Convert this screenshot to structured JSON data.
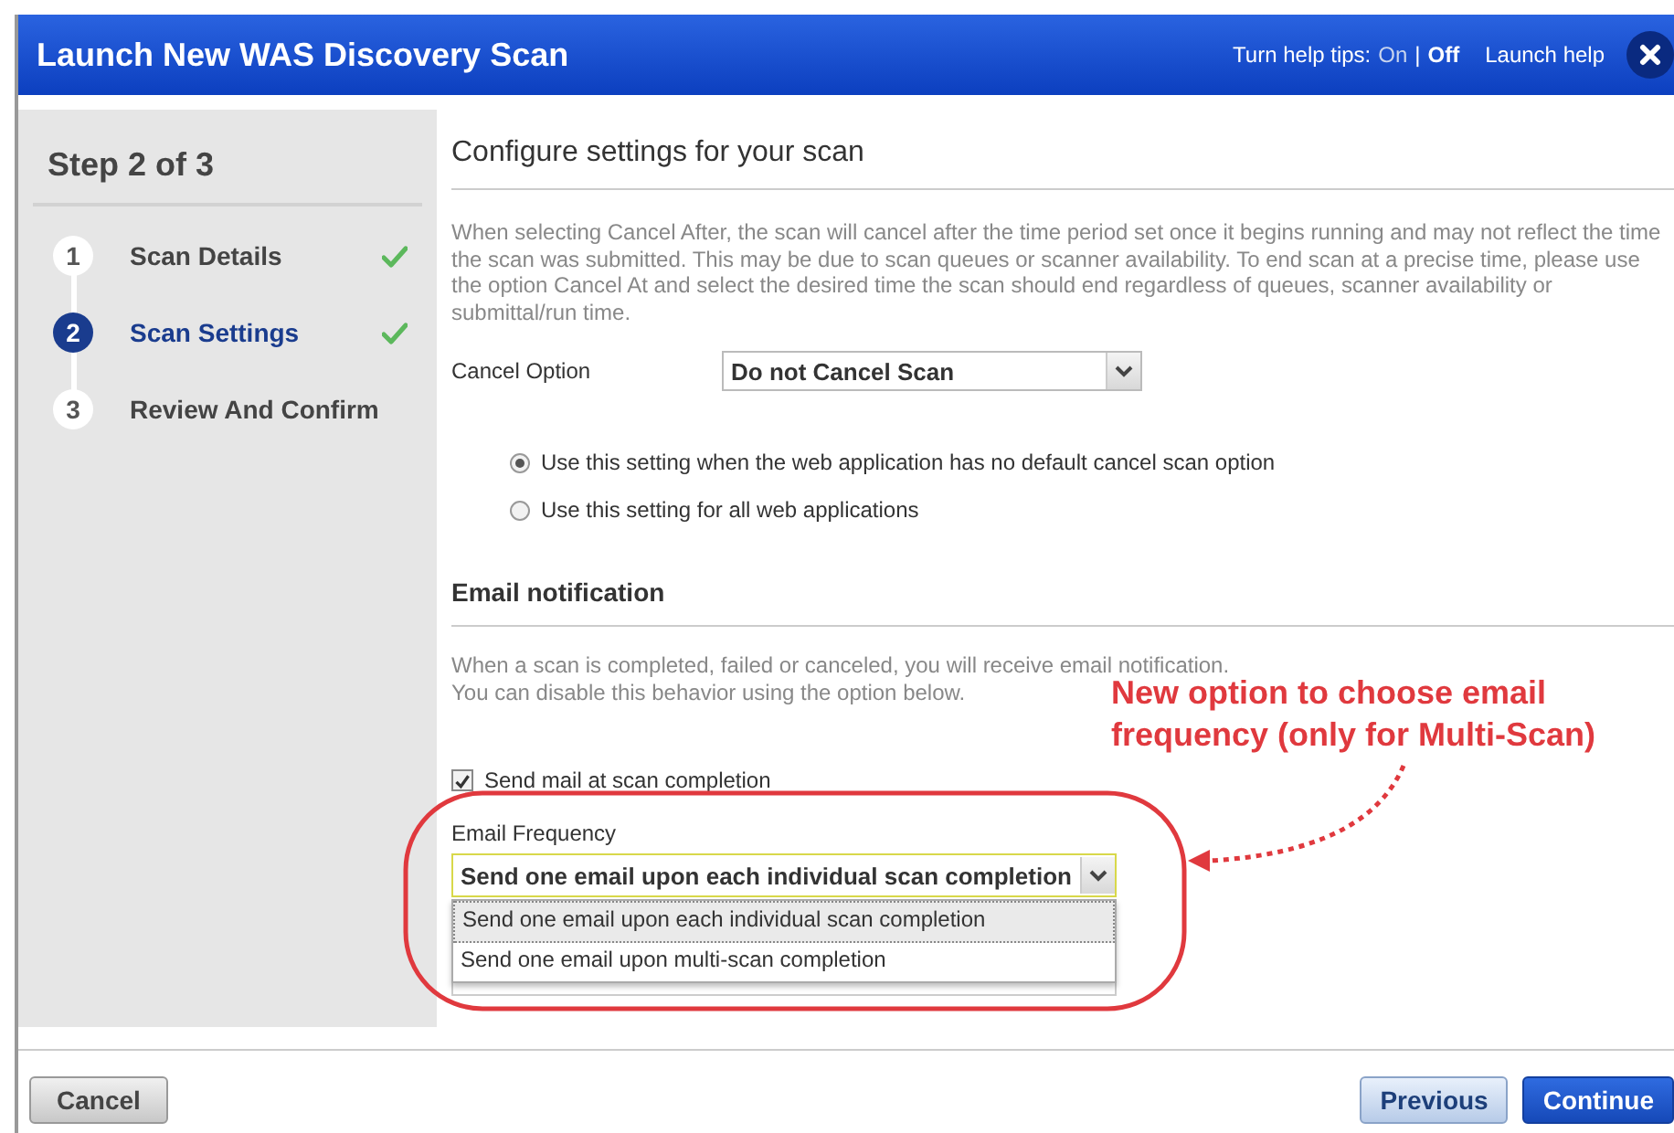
{
  "window": {
    "title": "Launch New WAS Discovery Scan",
    "help_tips_label": "Turn help tips:",
    "help_on": "On",
    "help_separator": "|",
    "help_off": "Off",
    "help_tips_on": false,
    "launch_help": "Launch help"
  },
  "sidebar": {
    "heading": "Step 2 of 3",
    "steps": [
      {
        "number": "1",
        "label": "Scan Details",
        "selected": false,
        "done": true
      },
      {
        "number": "2",
        "label": "Scan Settings",
        "selected": true,
        "done": true
      },
      {
        "number": "3",
        "label": "Review And Confirm",
        "selected": false,
        "done": false
      }
    ]
  },
  "content": {
    "title": "Configure settings for your scan",
    "cancel_description": "When selecting Cancel After, the scan will cancel after the time period set once it begins running and may not reflect the time the scan was submitted. This may be due to scan queues or scanner availability. To end scan at a precise time, please use the option Cancel At and select the desired time the scan should end regardless of queues, scanner availability or submittal/run time.",
    "cancel_option": {
      "label": "Cancel Option",
      "value": "Do not Cancel Scan"
    },
    "radios": [
      {
        "label": "Use this setting when the web application has no default cancel scan option",
        "selected": true
      },
      {
        "label": "Use this setting for all web applications",
        "selected": false
      }
    ],
    "email_heading": "Email notification",
    "email_description": [
      "When a scan is completed, failed or canceled, you will receive email notification.",
      "You can disable this behavior using the option below."
    ],
    "send_mail": {
      "label": "Send mail at scan completion",
      "checked": true
    },
    "email_frequency": {
      "label": "Email Frequency",
      "value": "Send one email upon each individual scan completion",
      "options": [
        {
          "label": "Send one email upon each individual scan completion",
          "selected": true
        },
        {
          "label": "Send one email upon multi-scan completion",
          "selected": false
        }
      ]
    }
  },
  "annotation": {
    "text": "New option to choose email frequency (only for Multi-Scan)"
  },
  "footer": {
    "cancel": "Cancel",
    "previous": "Previous",
    "continue": "Continue"
  }
}
